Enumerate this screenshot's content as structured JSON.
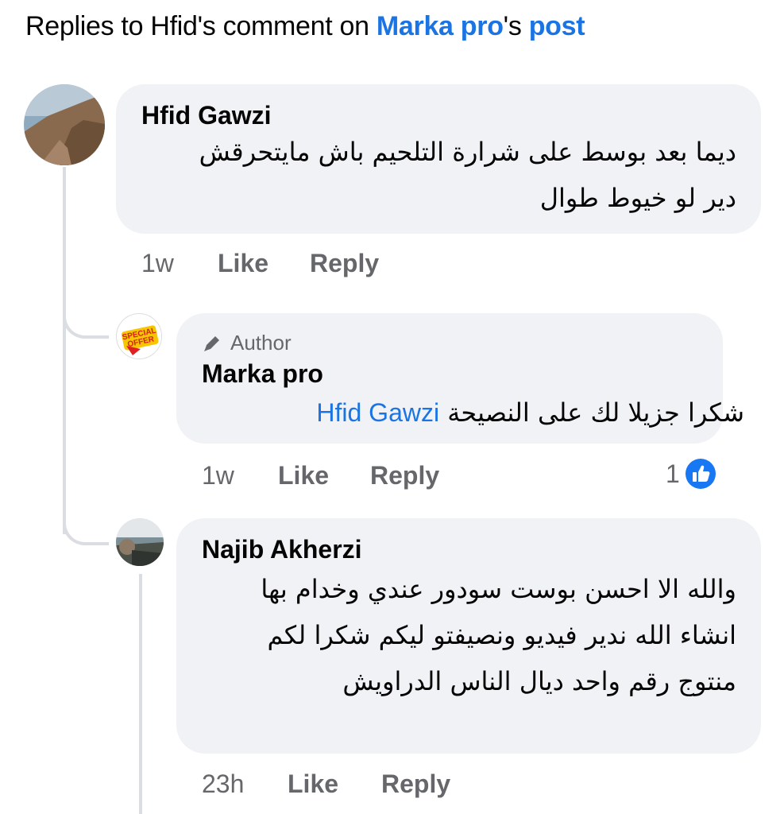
{
  "header": {
    "prefix": "Replies to Hfid's comment on ",
    "author_link": "Marka pro",
    "possessive": "'s ",
    "post_link": "post"
  },
  "comments": [
    {
      "author": "Hfid Gawzi",
      "lines": [
        "ديما بعد بوسط على شرارة التلحيم باش مايتحرقش",
        "دير لو خيوط طوال"
      ],
      "time": "1w",
      "like_label": "Like",
      "reply_label": "Reply"
    },
    {
      "badge": "Author",
      "author": "Marka pro",
      "text": "شكرا جزيلا لك على النصيحة",
      "mention": "Hfid Gawzi",
      "avatar_text": "SPECIAL OFFER",
      "time": "1w",
      "like_label": "Like",
      "reply_label": "Reply",
      "reaction_count": "1"
    },
    {
      "author": "Najib Akherzi",
      "lines": [
        "والله الا احسن بوست سودور عندي وخدام بها",
        "انشاء الله ندير فيديو ونصيفتو ليكم شكرا لكم",
        "منتوج رقم واحد ديال الناس الدراويش"
      ],
      "time": "23h",
      "like_label": "Like",
      "reply_label": "Reply"
    }
  ],
  "colors": {
    "link": "#1b74e4",
    "bubble": "#f0f2f5",
    "meta": "#65676b",
    "like_reaction": "#1877f2"
  },
  "icons": [
    "pencil-icon",
    "like-reaction-icon"
  ]
}
